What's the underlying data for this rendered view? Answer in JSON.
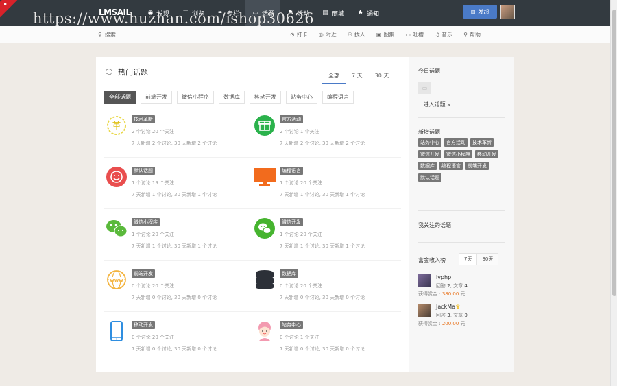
{
  "watermark": "https://www.huzhan.com/ishop30626",
  "topbar": {
    "logo": "LMSAIL",
    "nav": [
      {
        "icon": "eye-icon",
        "glyph": "◉",
        "label": "发现"
      },
      {
        "icon": "list-icon",
        "glyph": "☰",
        "label": "浏览"
      },
      {
        "icon": "pen-icon",
        "glyph": "✒",
        "label": "专栏"
      },
      {
        "icon": "chat-icon",
        "glyph": "▭",
        "label": "话题",
        "active": true
      },
      {
        "icon": "flag-icon",
        "glyph": "⚑",
        "label": "活动"
      },
      {
        "icon": "shop-icon",
        "glyph": "▤",
        "label": "商城"
      },
      {
        "icon": "bell-icon",
        "glyph": "♠",
        "label": "通知"
      }
    ],
    "publish_label": "发起"
  },
  "subbar": {
    "search_label": "搜索",
    "items": [
      {
        "icon": "signin-icon",
        "glyph": "⊙",
        "label": "打卡"
      },
      {
        "icon": "nearby-icon",
        "glyph": "◎",
        "label": "附近"
      },
      {
        "icon": "findpeople-icon",
        "glyph": "⚇",
        "label": "找人"
      },
      {
        "icon": "picture-icon",
        "glyph": "▣",
        "label": "图集"
      },
      {
        "icon": "comment-icon",
        "glyph": "▭",
        "label": "吐槽"
      },
      {
        "icon": "music-icon",
        "glyph": "♫",
        "label": "音乐"
      },
      {
        "icon": "help-icon",
        "glyph": "♀",
        "label": "帮助"
      }
    ]
  },
  "main": {
    "title": "热门话题",
    "tabs": [
      "全部",
      "7 天",
      "30 天"
    ],
    "categories": [
      "全部话题",
      "前端开发",
      "微信小程序",
      "数据库",
      "移动开发",
      "站务中心",
      "编程语言"
    ],
    "topics": [
      {
        "name": "技术革新",
        "stat": "2 个讨论 20 个关注",
        "new": "7 天新增 2 个讨论, 30 天新增 2 个讨论",
        "icon": "reform-icon"
      },
      {
        "name": "官方活动",
        "stat": "2 个讨论 1 个关注",
        "new": "7 天新增 2 个讨论, 30 天新增 2 个讨论",
        "icon": "gift-icon"
      },
      {
        "name": "默认话题",
        "stat": "1 个讨论 19 个关注",
        "new": "7 天新增 1 个讨论, 30 天新增 1 个讨论",
        "icon": "smile-icon"
      },
      {
        "name": "编程语言",
        "stat": "1 个讨论 20 个关注",
        "new": "7 天新增 1 个讨论, 30 天新增 1 个讨论",
        "icon": "monitor-icon"
      },
      {
        "name": "微信小程序",
        "stat": "1 个讨论 20 个关注",
        "new": "7 天新增 1 个讨论, 30 天新增 1 个讨论",
        "icon": "wechat-icon"
      },
      {
        "name": "微信开发",
        "stat": "1 个讨论 20 个关注",
        "new": "7 天新增 1 个讨论, 30 天新增 1 个讨论",
        "icon": "wechat-circle-icon"
      },
      {
        "name": "前端开发",
        "stat": "0 个讨论 20 个关注",
        "new": "7 天新增 0 个讨论, 30 天新增 0 个讨论",
        "icon": "www-globe-icon"
      },
      {
        "name": "数据库",
        "stat": "0 个讨论 20 个关注",
        "new": "7 天新增 0 个讨论, 30 天新增 0 个讨论",
        "icon": "database-icon"
      },
      {
        "name": "移动开发",
        "stat": "0 个讨论 20 个关注",
        "new": "7 天新增 0 个讨论, 30 天新增 0 个讨论",
        "icon": "phone-icon"
      },
      {
        "name": "站务中心",
        "stat": "0 个讨论 1 个关注",
        "new": "7 天新增 0 个讨论, 30 天新增 0 个讨论",
        "icon": "service-girl-icon"
      }
    ]
  },
  "sidebar": {
    "today_title": "今日话题",
    "enter_link": "...进入话题 »",
    "new_title": "新增话题",
    "new_tags": [
      "站务中心",
      "官方活动",
      "技术革新",
      "微信开发",
      "微信小程序",
      "移动开发",
      "数据库",
      "编程语言",
      "前端开发",
      "默认话题"
    ],
    "follow_title": "我关注的话题",
    "rank_title": "富金收入榜",
    "rank_tabs": [
      "7天",
      "30天"
    ],
    "rank": [
      {
        "name": "lvphp",
        "meta_a": "回答 ",
        "a": "2",
        "meta_b": ", 文章 ",
        "b": "4",
        "earn_label": "获得赏金 : ",
        "amount": "380.00",
        "unit": " 元",
        "vip": false
      },
      {
        "name": "JackMa",
        "meta_a": "回答 ",
        "a": "3",
        "meta_b": ", 文章 ",
        "b": "0",
        "earn_label": "获得赏金 : ",
        "amount": "200.00",
        "unit": " 元",
        "vip": true
      }
    ]
  },
  "colors": {
    "topbar": "#333a40",
    "accent": "#4a7ac7",
    "tag": "#777777",
    "earn": "#e8731d"
  }
}
